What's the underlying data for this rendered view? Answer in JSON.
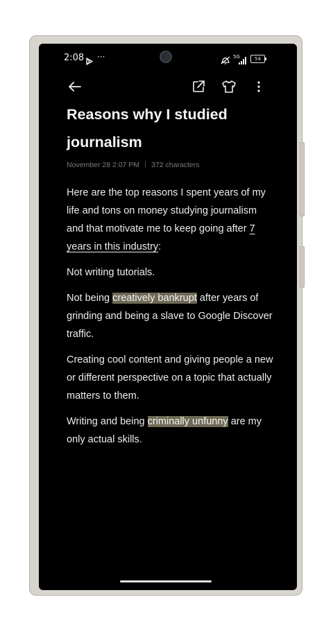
{
  "status_bar": {
    "time": "2:08",
    "overflow": "···",
    "network": "5G",
    "battery": "54"
  },
  "toolbar": {
    "back_icon": "arrow-left-icon",
    "share_icon": "external-link-icon",
    "theme_icon": "t-shirt-icon",
    "menu_icon": "more-vertical-icon"
  },
  "note": {
    "title": "Reasons why I studied journalism",
    "date": "November 28 2:07 PM",
    "char_count": "372 characters",
    "p1_a": "Here are the top reasons I spent years of my life and tons on money studying journalism and that motivate me to keep going after ",
    "p1_link": "7 years in this industry",
    "p1_b": ":",
    "p2": "Not writing tutorials.",
    "p3_a": "Not being ",
    "p3_hl": "creatively bankrupt",
    "p3_b": " after years of grinding and being a slave to Google Discover traffic.",
    "p4": "Creating cool content and giving people a new or different perspective on a topic that actually matters to them.",
    "p5_a": "Writing and being ",
    "p5_hl": "criminally unfunny",
    "p5_b": " are my only actual skills."
  },
  "colors": {
    "background": "#000000",
    "highlight": "#6e6a55",
    "frame": "#d8d5cf"
  }
}
